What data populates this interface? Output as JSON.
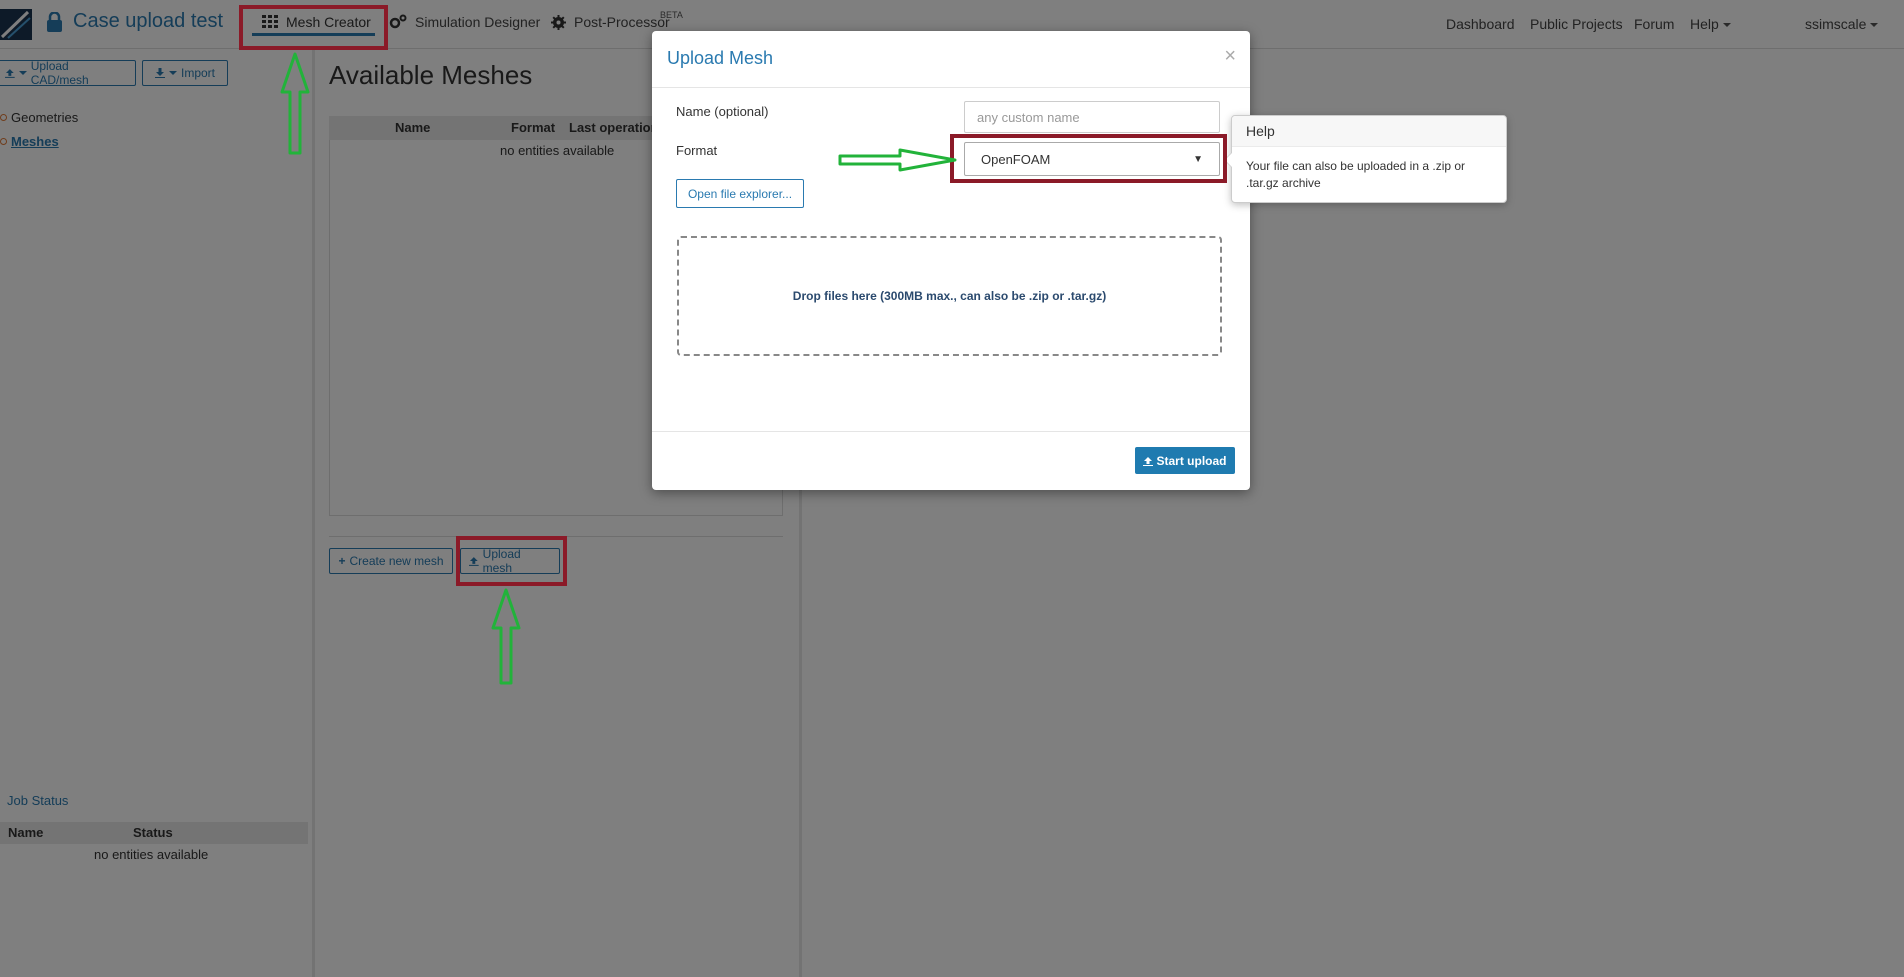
{
  "navbar": {
    "project_title": "Case upload test",
    "tabs": [
      {
        "label": "Mesh Creator",
        "icon": "grid-icon"
      },
      {
        "label": "Simulation Designer",
        "icon": "gears-icon"
      },
      {
        "label": "Post-Processor",
        "icon": "cog-icon",
        "badge": "BETA"
      }
    ],
    "right_links": [
      "Dashboard",
      "Public Projects",
      "Forum",
      "Help"
    ],
    "user": "ssimscale"
  },
  "sidebar": {
    "buttons": [
      "Upload CAD/mesh",
      "Import"
    ],
    "tree": [
      "Geometries",
      "Meshes"
    ]
  },
  "main": {
    "title": "Available Meshes",
    "columns": [
      "Name",
      "Format",
      "Last operation"
    ],
    "empty_text": "no entities available",
    "create_button": "Create new mesh",
    "upload_button": "Upload mesh"
  },
  "job_status": {
    "title": "Job Status",
    "columns": [
      "Name",
      "Status"
    ],
    "empty_text": "no entities available"
  },
  "modal": {
    "title": "Upload Mesh",
    "close": "×",
    "name_label": "Name (optional)",
    "name_placeholder": "any custom name",
    "format_label": "Format",
    "format_value": "OpenFOAM",
    "file_button": "Open file explorer...",
    "dropzone_text": "Drop files here (300MB max., can also be .zip or .tar.gz)",
    "start_button": "Start upload"
  },
  "popover": {
    "title": "Help",
    "body": "Your file can also be uploaded in a .zip or .tar.gz archive"
  },
  "colors": {
    "accent": "#2a7ab0",
    "primary_button": "#1f7bb0",
    "highlight_box": "#8b1a28",
    "annotation_arrow": "#22b33a"
  }
}
